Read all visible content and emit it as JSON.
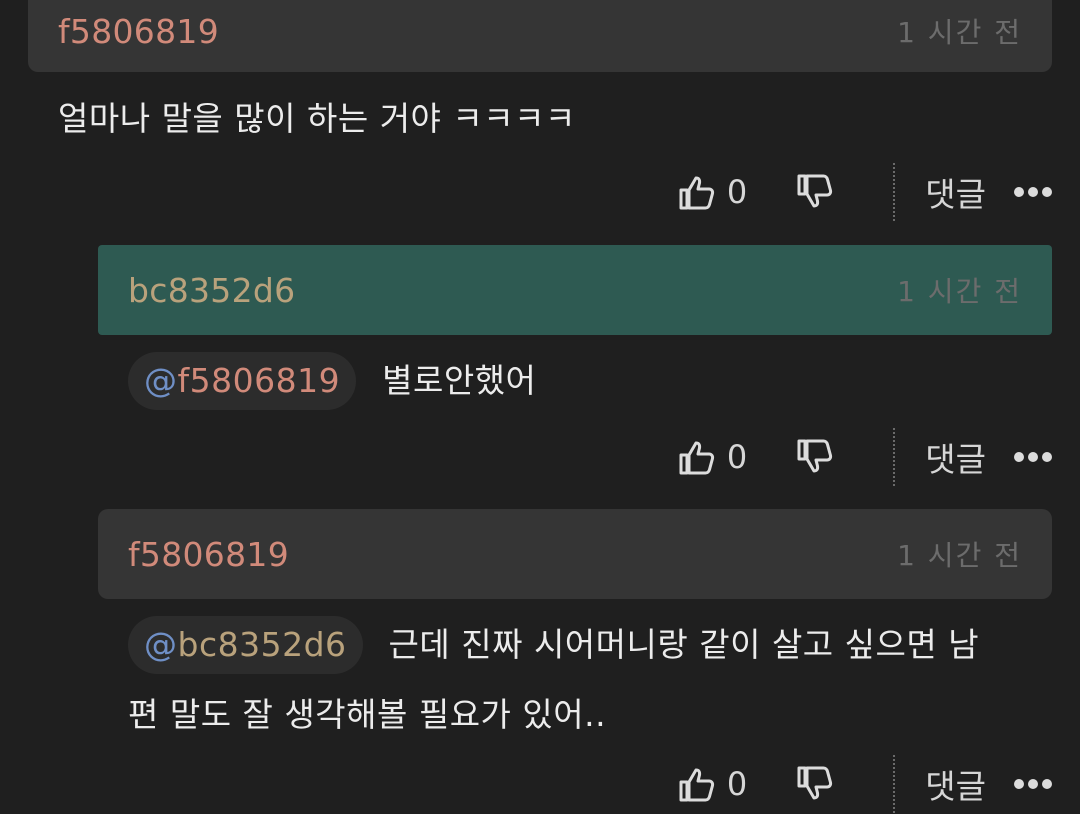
{
  "colors": {
    "background": "#1f1f1f",
    "header_default": "#353535",
    "header_highlight": "#2e5a52",
    "author_red": "#d18a7a",
    "author_gold": "#b9a27c",
    "mention_blue": "#6f8fc6"
  },
  "comments": [
    {
      "author": "f5806819",
      "time": "1 시간 전",
      "mention": "",
      "text": "얼마나 말을 많이 하는 거야 ㅋㅋㅋㅋ",
      "like_count": "0",
      "reply_label": "댓글"
    },
    {
      "author": "bc8352d6",
      "time": "1 시간 전",
      "mention_at": "@",
      "mention": "f5806819",
      "text": "별로안했어",
      "like_count": "0",
      "reply_label": "댓글"
    },
    {
      "author": "f5806819",
      "time": "1 시간 전",
      "mention_at": "@",
      "mention": "bc8352d6",
      "text_line1": "근데 진짜 시어머니랑 같이 살고 싶으면 남",
      "text_line2": "편 말도 잘 생각해볼 필요가 있어..",
      "like_count": "0",
      "reply_label": "댓글"
    }
  ],
  "icons": [
    "thumbs-up-icon",
    "thumbs-down-icon",
    "more-dots-icon"
  ]
}
